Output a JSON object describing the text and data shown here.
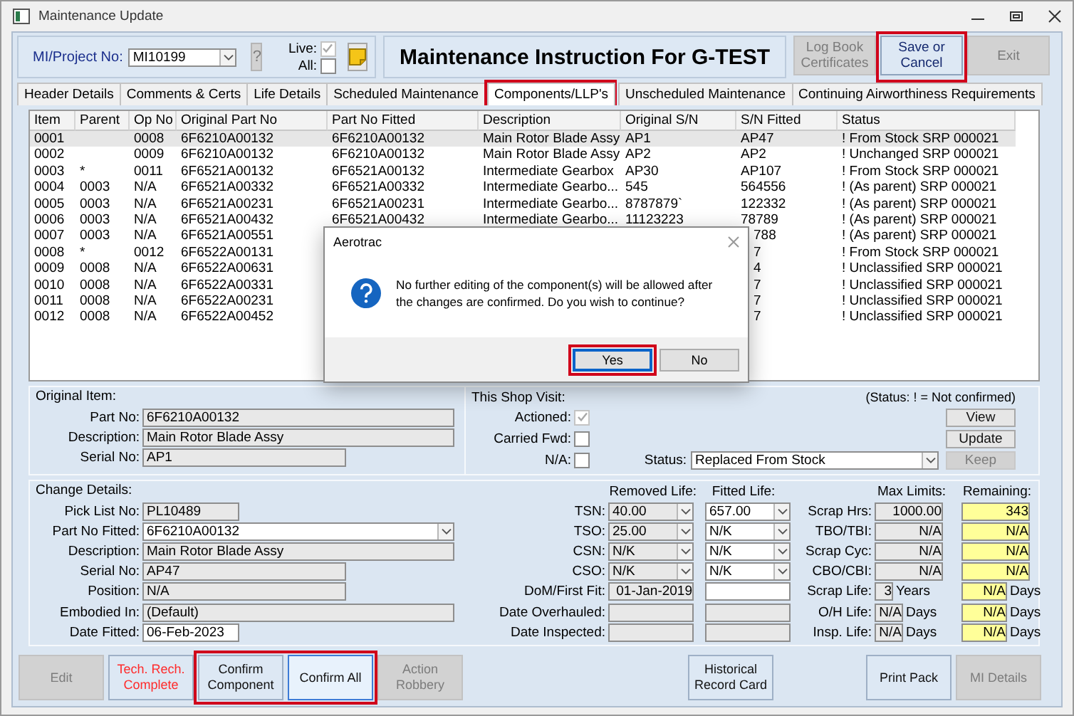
{
  "window": {
    "title": "Maintenance Update"
  },
  "toolbar": {
    "project_label": "MI/Project No:",
    "project_value": "MI10199",
    "help_button": {
      "label": "?",
      "disabled": true
    },
    "checks": [
      {
        "label": "Live:",
        "checked": true,
        "disabled": true
      },
      {
        "label": "All:",
        "checked": false,
        "disabled": false
      }
    ],
    "heading": "Maintenance Instruction For G-TEST",
    "buttons": [
      {
        "label": "Log Book Certificates",
        "disabled": true,
        "highlighted": false
      },
      {
        "label": "Save or Cancel",
        "disabled": false,
        "highlighted": true
      },
      {
        "label": "Exit",
        "disabled": true,
        "highlighted": false
      }
    ]
  },
  "tabs": [
    {
      "label": "Header Details",
      "selected": false,
      "highlighted": false
    },
    {
      "label": "Comments & Certs",
      "selected": false,
      "highlighted": false
    },
    {
      "label": "Life Details",
      "selected": false,
      "highlighted": false
    },
    {
      "label": "Scheduled Maintenance",
      "selected": false,
      "highlighted": false
    },
    {
      "label": "Components/LLP's",
      "selected": true,
      "highlighted": true
    },
    {
      "label": "Unscheduled Maintenance",
      "selected": false,
      "highlighted": false
    },
    {
      "label": "Continuing Airworthiness Requirements",
      "selected": false,
      "highlighted": false
    }
  ],
  "table": {
    "columns": [
      "Item",
      "Parent",
      "Op No",
      "Original Part No",
      "Part No Fitted",
      "Description",
      "Original S/N",
      "S/N Fitted",
      "Status"
    ],
    "rows": [
      {
        "item": "0001",
        "op_no": "0008",
        "original_part_no": "6F6210A00132",
        "part_no_fitted": "6F6210A00132",
        "description": "Main Rotor Blade Assy",
        "original_sn": "AP1",
        "sn_fitted": "AP47",
        "status": "! From Stock SRP 000021",
        "selected": true
      },
      {
        "item": "0002",
        "op_no": "0009",
        "original_part_no": "6F6210A00132",
        "part_no_fitted": "6F6210A00132",
        "description": "Main Rotor Blade Assy",
        "original_sn": "AP2",
        "sn_fitted": "AP2",
        "status": "! Unchanged SRP 000021",
        "selected": false
      },
      {
        "item": "0003",
        "parent": "*",
        "op_no": "0011",
        "original_part_no": "6F6521A00132",
        "part_no_fitted": "6F6521A00132",
        "description": "Intermediate Gearbox",
        "original_sn": "AP30",
        "sn_fitted": "AP107",
        "status": "! From Stock SRP 000021",
        "selected": false
      },
      {
        "item": "0004",
        "parent": "0003",
        "op_no": "N/A",
        "original_part_no": "6F6521A00332",
        "part_no_fitted": "6F6521A00332",
        "description": "Intermediate Gearbo...",
        "original_sn": "545",
        "sn_fitted": "564556",
        "status": "! (As parent) SRP 000021",
        "selected": false
      },
      {
        "item": "0005",
        "parent": "0003",
        "op_no": "N/A",
        "original_part_no": "6F6521A00231",
        "part_no_fitted": "6F6521A00231",
        "description": "Intermediate Gearbo...",
        "original_sn": "8787879`",
        "sn_fitted": "122332",
        "status": "! (As parent) SRP 000021",
        "selected": false
      },
      {
        "item": "0006",
        "parent": "0003",
        "op_no": "N/A",
        "original_part_no": "6F6521A00432",
        "part_no_fitted": "6F6521A00432",
        "description": "Intermediate Gearbo...",
        "original_sn": "11123223",
        "sn_fitted": "78789",
        "status": "! (As parent) SRP 000021",
        "selected": false
      },
      {
        "item": "0007",
        "parent": "0003",
        "op_no": "N/A",
        "original_part_no": "6F6521A00551",
        "sn_fitted": "788",
        "status": "! (As parent) SRP 000021",
        "selected": false
      },
      {
        "item": "0008",
        "parent": "*",
        "op_no": "0012",
        "original_part_no": "6F6522A00131",
        "sn_fitted": "7",
        "status": "! From Stock SRP 000021",
        "selected": false
      },
      {
        "item": "0009",
        "parent": "0008",
        "op_no": "N/A",
        "original_part_no": "6F6522A00631",
        "sn_fitted": "4",
        "status": "! Unclassified SRP 000021",
        "selected": false
      },
      {
        "item": "0010",
        "parent": "0008",
        "op_no": "N/A",
        "original_part_no": "6F6522A00331",
        "sn_fitted": "7",
        "status": "! Unclassified SRP 000021",
        "selected": false
      },
      {
        "item": "0011",
        "parent": "0008",
        "op_no": "N/A",
        "original_part_no": "6F6522A00231",
        "sn_fitted": "7",
        "status": "! Unclassified SRP 000021",
        "selected": false
      },
      {
        "item": "0012",
        "parent": "0008",
        "op_no": "N/A",
        "original_part_no": "6F6522A00452",
        "sn_fitted": "7",
        "status": "! Unclassified SRP 000021",
        "selected": false
      }
    ]
  },
  "dialog": {
    "title": "Aerotrac",
    "message": "No further editing of the component(s) will be allowed after the changes are confirmed. Do you wish to continue?",
    "buttons": [
      {
        "label": "Yes",
        "focused": true,
        "highlighted": true
      },
      {
        "label": "No",
        "focused": false,
        "highlighted": false
      }
    ]
  },
  "original_item": {
    "title": "Original Item:",
    "fields": [
      {
        "label": "Part No:",
        "value": "6F6210A00132",
        "kind": "readonly"
      },
      {
        "label": "Description:",
        "value": "Main Rotor Blade Assy",
        "kind": "readonly"
      },
      {
        "label": "Serial No:",
        "value": "AP1",
        "kind": "readonly"
      }
    ]
  },
  "shop_visit": {
    "title": "This Shop Visit:",
    "note": "(Status: ! = Not confirmed)",
    "checks": [
      {
        "label": "Actioned:",
        "checked": true,
        "disabled": true
      },
      {
        "label": "Carried Fwd:",
        "checked": false,
        "disabled": false
      },
      {
        "label": "N/A:",
        "checked": false,
        "disabled": false
      }
    ],
    "status": {
      "label": "Status:",
      "value": "Replaced From Stock"
    },
    "buttons": [
      {
        "label": "View",
        "disabled": false
      },
      {
        "label": "Update",
        "disabled": false
      },
      {
        "label": "Keep",
        "disabled": true
      }
    ]
  },
  "change_details": {
    "title": "Change Details:",
    "fields": [
      {
        "label": "Pick List No:",
        "value": "PL10489",
        "kind": "readonly",
        "dropdown": false
      },
      {
        "label": "Part No Fitted:",
        "value": "6F6210A00132",
        "kind": "editable",
        "dropdown": true
      },
      {
        "label": "Description:",
        "value": "Main Rotor Blade Assy",
        "kind": "readonly",
        "dropdown": false
      },
      {
        "label": "Serial No:",
        "value": "AP47",
        "kind": "readonly",
        "dropdown": false
      },
      {
        "label": "Position:",
        "value": "N/A",
        "kind": "readonly",
        "dropdown": false
      },
      {
        "label": "Embodied In:",
        "value": "(Default)",
        "kind": "readonly",
        "dropdown": false
      },
      {
        "label": "Date Fitted:",
        "value": "06-Feb-2023",
        "kind": "editable",
        "dropdown": false
      }
    ],
    "life_headers": [
      "Removed Life:",
      "Fitted Life:"
    ],
    "life_rows": [
      {
        "label": "TSN:",
        "removed": {
          "value": "40.00",
          "kind": "readonly",
          "dropdown": true
        },
        "fitted": {
          "value": "657.00",
          "kind": "editable",
          "dropdown": true
        }
      },
      {
        "label": "TSO:",
        "removed": {
          "value": "25.00",
          "kind": "readonly",
          "dropdown": true
        },
        "fitted": {
          "value": "N/K",
          "kind": "editable",
          "dropdown": true
        }
      },
      {
        "label": "CSN:",
        "removed": {
          "value": "N/K",
          "kind": "readonly",
          "dropdown": true
        },
        "fitted": {
          "value": "N/K",
          "kind": "editable",
          "dropdown": true
        }
      },
      {
        "label": "CSO:",
        "removed": {
          "value": "N/K",
          "kind": "readonly",
          "dropdown": true
        },
        "fitted": {
          "value": "N/K",
          "kind": "editable",
          "dropdown": true
        }
      },
      {
        "label": "DoM/First Fit:",
        "removed": {
          "value": "01-Jan-2019",
          "kind": "readonly",
          "dropdown": false
        },
        "fitted": {
          "kind": "editable",
          "dropdown": false
        }
      },
      {
        "label": "Date Overhauled:",
        "removed": {
          "kind": "readonly",
          "dropdown": false
        },
        "fitted": {
          "kind": "readonly",
          "dropdown": false
        }
      },
      {
        "label": "Date Inspected:",
        "removed": {
          "kind": "readonly",
          "dropdown": false
        },
        "fitted": {
          "kind": "readonly",
          "dropdown": false
        }
      }
    ],
    "limit_headers": [
      "Max Limits:",
      "Remaining:"
    ],
    "limit_rows": [
      {
        "label": "Scrap Hrs:",
        "max": {
          "value": "1000.00",
          "kind": "readonly"
        },
        "remaining": {
          "value": "343",
          "kind": "highlight"
        }
      },
      {
        "label": "TBO/TBI:",
        "max": {
          "value": "N/A",
          "kind": "readonly"
        },
        "remaining": {
          "value": "N/A",
          "kind": "highlight"
        }
      },
      {
        "label": "Scrap Cyc:",
        "max": {
          "value": "N/A",
          "kind": "readonly"
        },
        "remaining": {
          "value": "N/A",
          "kind": "highlight"
        }
      },
      {
        "label": "CBO/CBI:",
        "max": {
          "value": "N/A",
          "kind": "readonly"
        },
        "remaining": {
          "value": "N/A",
          "kind": "highlight"
        }
      },
      {
        "label": "Scrap Life:",
        "max": {
          "value": "3",
          "unit": "Years",
          "kind": "readonly"
        },
        "remaining": {
          "value": "N/A",
          "unit": "Days",
          "kind": "highlight"
        }
      },
      {
        "label": "O/H Life:",
        "max": {
          "value": "N/A",
          "unit": "Days",
          "kind": "readonly"
        },
        "remaining": {
          "value": "N/A",
          "unit": "Days",
          "kind": "highlight"
        }
      },
      {
        "label": "Insp. Life:",
        "max": {
          "value": "N/A",
          "unit": "Days",
          "kind": "readonly"
        },
        "remaining": {
          "value": "N/A",
          "unit": "Days",
          "kind": "highlight"
        }
      }
    ]
  },
  "footer": {
    "left": [
      {
        "label": "Edit",
        "disabled": true,
        "alert": false,
        "focused": false,
        "highlighted": false
      },
      {
        "label": "Tech. Rech. Complete",
        "disabled": false,
        "alert": true,
        "focused": false,
        "highlighted": false
      },
      {
        "label": "Confirm Component",
        "disabled": false,
        "alert": false,
        "focused": false,
        "highlighted": true
      },
      {
        "label": "Confirm All",
        "disabled": false,
        "alert": false,
        "focused": true,
        "highlighted": true
      },
      {
        "label": "Action Robbery",
        "disabled": true,
        "alert": false,
        "focused": false,
        "highlighted": false
      }
    ],
    "middle": [
      {
        "label": "Historical Record Card",
        "disabled": false,
        "alert": false,
        "focused": false,
        "highlighted": false
      }
    ],
    "right": [
      {
        "label": "Print Pack",
        "disabled": false,
        "alert": false,
        "focused": false,
        "highlighted": false
      },
      {
        "label": "MI Details",
        "disabled": true,
        "alert": false,
        "focused": false,
        "highlighted": false
      }
    ]
  }
}
